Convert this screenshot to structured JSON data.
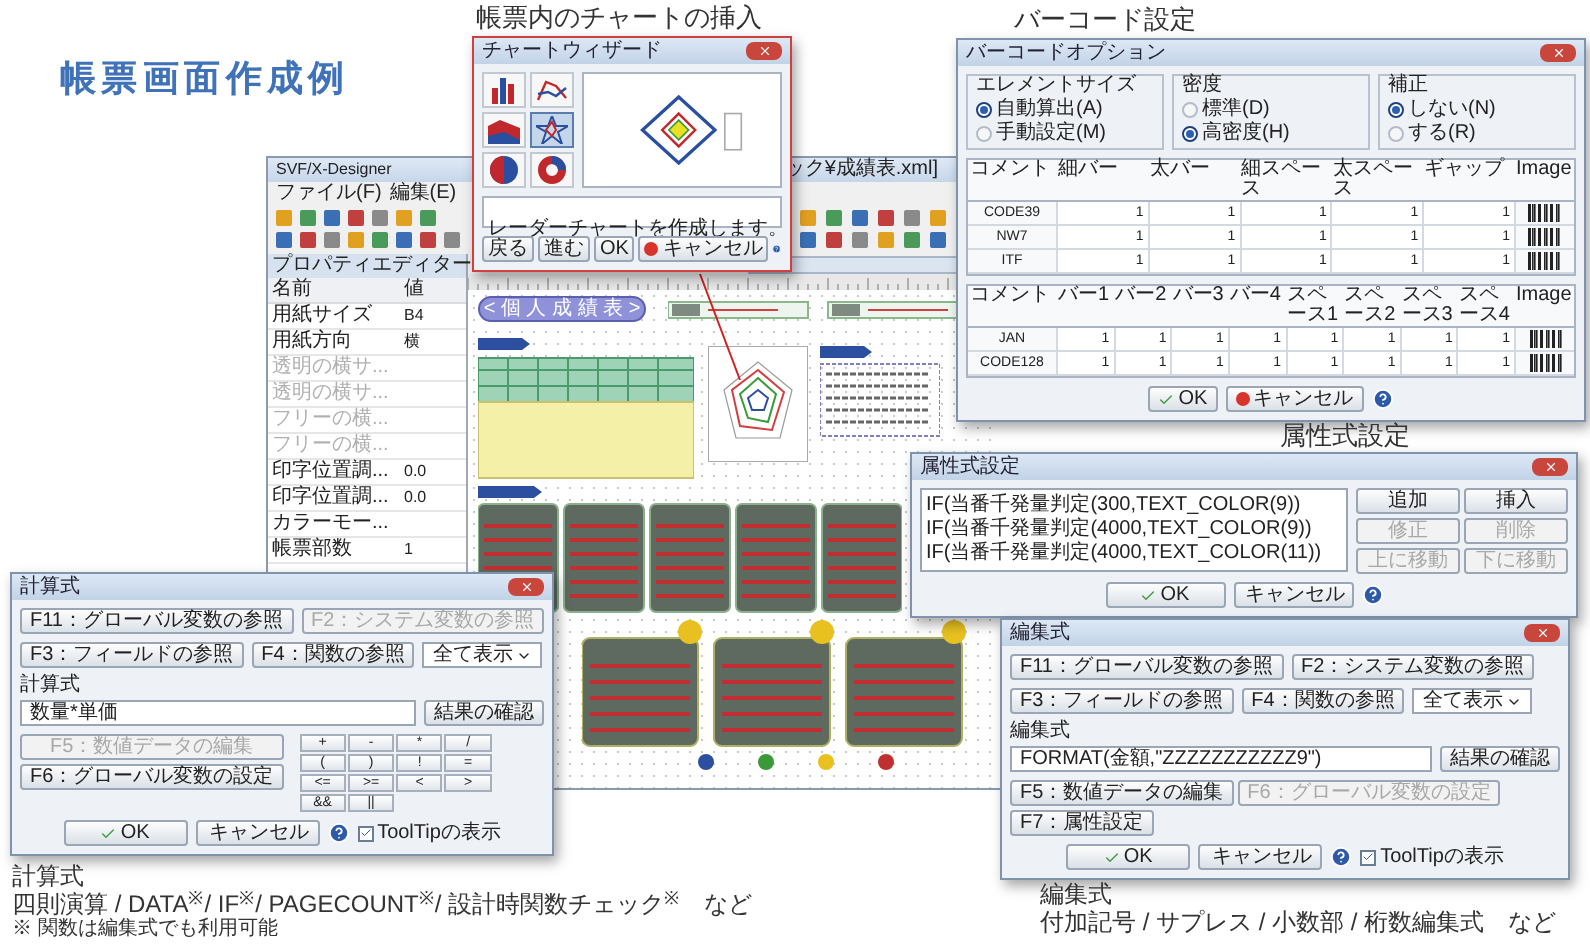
{
  "page_title": "帳票画面作成例",
  "chart_wizard": {
    "caption": "帳票内のチャートの挿入",
    "title": "チャートウィザード",
    "chart_types": [
      {
        "kind": "bar",
        "selected": false
      },
      {
        "kind": "line",
        "selected": false
      },
      {
        "kind": "area",
        "selected": false
      },
      {
        "kind": "radar",
        "selected": true
      },
      {
        "kind": "pie",
        "selected": false
      },
      {
        "kind": "donut",
        "selected": false
      }
    ],
    "description": "レーダーチャートを作成します。",
    "buttons": [
      {
        "label": "戻る",
        "kind": "plain"
      },
      {
        "label": "進む",
        "kind": "plain"
      },
      {
        "label": "OK",
        "kind": "plain"
      },
      {
        "label": "キャンセル",
        "kind": "cancel"
      }
    ]
  },
  "designer": {
    "title": "SVF/X-Designer",
    "title_tail": "ック¥成績表.xml]",
    "menu": [
      "ファイル(F)",
      "編集(E)"
    ],
    "property_editor": {
      "title": "プロパティエディター",
      "header": [
        "名前",
        "値"
      ],
      "rows": [
        {
          "name": "用紙サイズ",
          "value": "B4",
          "disabled": false
        },
        {
          "name": "用紙方向",
          "value": "横",
          "disabled": false
        },
        {
          "name": "透明の横サ...",
          "value": "",
          "disabled": true
        },
        {
          "name": "透明の横サ...",
          "value": "",
          "disabled": true
        },
        {
          "name": "フリーの横...",
          "value": "",
          "disabled": true
        },
        {
          "name": "フリーの横...",
          "value": "",
          "disabled": true
        },
        {
          "name": "印字位置調...",
          "value": "0.0",
          "disabled": false
        },
        {
          "name": "印字位置調...",
          "value": "0.0",
          "disabled": false
        },
        {
          "name": "カラーモー...",
          "value": "",
          "disabled": false
        },
        {
          "name": "帳票部数",
          "value": "1",
          "disabled": false
        }
      ]
    },
    "report_title": "< 個 人 成 績 表 >"
  },
  "barcode": {
    "caption": "バーコード設定",
    "title": "バーコードオプション",
    "groups": [
      {
        "title": "エレメントサイズ",
        "options": [
          {
            "label": "自動算出(A)",
            "selected": true
          },
          {
            "label": "手動設定(M)",
            "selected": false
          }
        ]
      },
      {
        "title": "密度",
        "options": [
          {
            "label": "標準(D)",
            "selected": false
          },
          {
            "label": "高密度(H)",
            "selected": true
          }
        ]
      },
      {
        "title": "補正",
        "options": [
          {
            "label": "しない(N)",
            "selected": true
          },
          {
            "label": "する(R)",
            "selected": false
          }
        ]
      }
    ],
    "table1": {
      "columns": [
        "コメント",
        "細バー",
        "太バー",
        "細スペース",
        "太スペース",
        "ギャップ",
        "Image"
      ],
      "rows": [
        {
          "name": "CODE39",
          "values": [
            "1",
            "1",
            "1",
            "1",
            "1"
          ]
        },
        {
          "name": "NW7",
          "values": [
            "1",
            "1",
            "1",
            "1",
            "1"
          ]
        },
        {
          "name": "ITF",
          "values": [
            "1",
            "1",
            "1",
            "1",
            "1"
          ]
        }
      ]
    },
    "table2": {
      "columns": [
        "コメント",
        "バー1",
        "バー2",
        "バー3",
        "バー4",
        "スペース1",
        "スペース2",
        "スペース3",
        "スペース4",
        "Image"
      ],
      "rows": [
        {
          "name": "JAN",
          "values": [
            "1",
            "1",
            "1",
            "1",
            "1",
            "1",
            "1",
            "1"
          ]
        },
        {
          "name": "CODE128",
          "values": [
            "1",
            "1",
            "1",
            "1",
            "1",
            "1",
            "1",
            "1"
          ]
        }
      ]
    },
    "buttons": [
      {
        "label": "OK",
        "kind": "ok"
      },
      {
        "label": "キャンセル",
        "kind": "cancel"
      }
    ]
  },
  "attribute": {
    "caption": "属性式設定",
    "title": "属性式設定",
    "lines": [
      "IF(当番千発量判定(300,TEXT_COLOR(9))",
      "IF(当番千発量判定(4000,TEXT_COLOR(9))",
      "IF(当番千発量判定(4000,TEXT_COLOR(11))"
    ],
    "side_buttons": [
      {
        "label": "追加",
        "disabled": false
      },
      {
        "label": "挿入",
        "disabled": false
      },
      {
        "label": "修正",
        "disabled": true
      },
      {
        "label": "削除",
        "disabled": true
      },
      {
        "label": "上に移動",
        "disabled": true
      },
      {
        "label": "下に移動",
        "disabled": true
      }
    ],
    "buttons": [
      {
        "label": "OK",
        "kind": "ok"
      },
      {
        "label": "キャンセル",
        "kind": "cancel"
      }
    ]
  },
  "calc": {
    "title": "計算式",
    "ref_buttons": [
      {
        "label": "F11：グローバル変数の参照",
        "disabled": false
      },
      {
        "label": "F2：システム変数の参照",
        "disabled": true
      },
      {
        "label": "F3：フィールドの参照",
        "disabled": false
      },
      {
        "label": "F4：関数の参照",
        "disabled": false
      }
    ],
    "filter": "全て表示",
    "field_label": "計算式",
    "value": "数量*単価",
    "check_button": "結果の確認",
    "tool_buttons": [
      {
        "label": "F5：数値データの編集",
        "disabled": true
      },
      {
        "label": "F6：グローバル変数の設定",
        "disabled": false
      }
    ],
    "keys": [
      "+",
      "-",
      "*",
      "/",
      "(",
      ")",
      "!",
      "=",
      "<=",
      ">=",
      "<",
      ">",
      "&&",
      "||"
    ],
    "buttons": [
      {
        "label": "OK",
        "kind": "ok"
      },
      {
        "label": "キャンセル",
        "kind": "cancel"
      }
    ],
    "tooltip": {
      "label": "ToolTipの表示",
      "checked": true
    },
    "caption": "計算式",
    "features": "四則演算 / DATA$^{※}$/ IF$^{※}$/ PAGECOUNT$^{※}$/ 設計時関数チェック$^{※}$　など",
    "note": "※ 関数は編集式でも利用可能"
  },
  "edit": {
    "title": "編集式",
    "ref_buttons": [
      {
        "label": "F11：グローバル変数の参照",
        "disabled": false
      },
      {
        "label": "F2：システム変数の参照",
        "disabled": false
      },
      {
        "label": "F3：フィールドの参照",
        "disabled": false
      },
      {
        "label": "F4：関数の参照",
        "disabled": false
      }
    ],
    "filter": "全て表示",
    "field_label": "編集式",
    "value": "FORMAT(金額,\"ZZZZZZZZZZZ9\")",
    "check_button": "結果の確認",
    "tool_buttons": [
      {
        "label": "F5：数値データの編集",
        "disabled": false
      },
      {
        "label": "F6：グローバル変数の設定",
        "disabled": true
      },
      {
        "label": "F7：属性設定",
        "disabled": false
      }
    ],
    "buttons": [
      {
        "label": "OK",
        "kind": "ok"
      },
      {
        "label": "キャンセル",
        "kind": "cancel"
      }
    ],
    "tooltip": {
      "label": "ToolTipの表示",
      "checked": true
    },
    "caption": "編集式",
    "features": "付加記号 / サプレス / 小数部 / 桁数編集式　など"
  }
}
